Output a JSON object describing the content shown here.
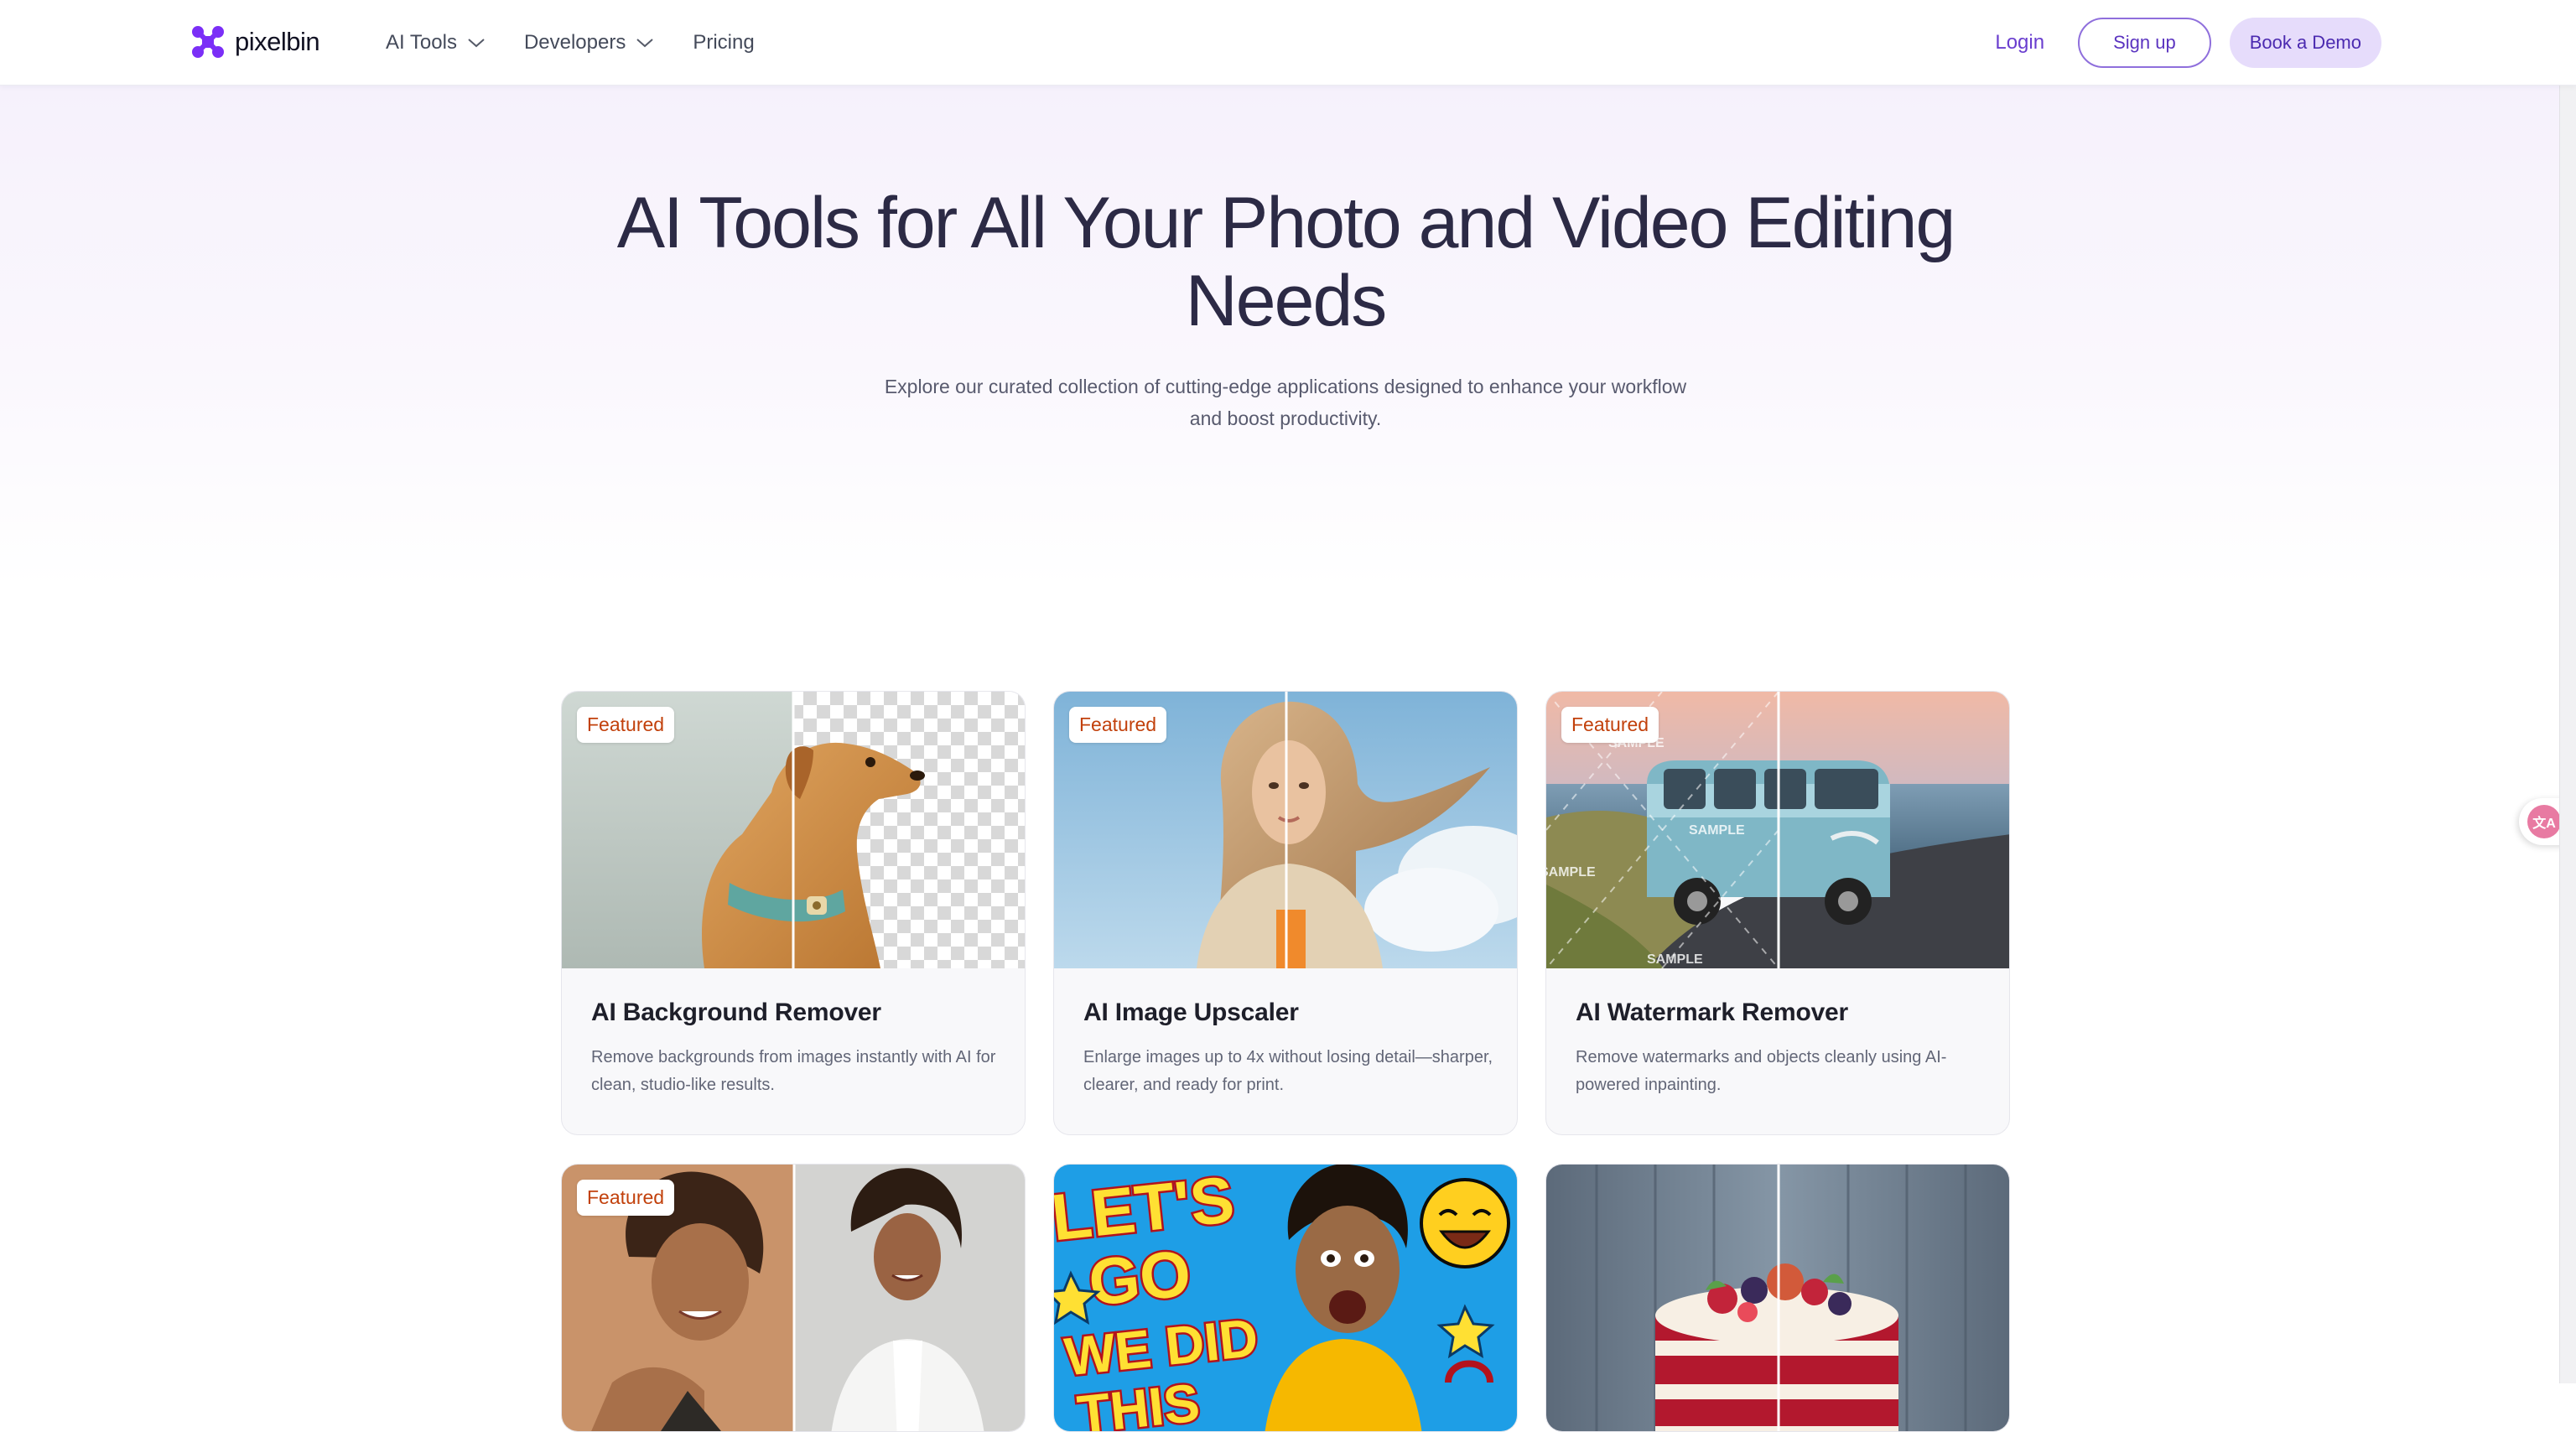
{
  "brand": {
    "name": "pixelbin",
    "accent": "#7b2ff7"
  },
  "nav": {
    "items": [
      {
        "label": "AI Tools"
      },
      {
        "label": "Developers"
      },
      {
        "label": "Pricing"
      }
    ]
  },
  "header_actions": {
    "login": "Login",
    "signup": "Sign up",
    "demo": "Book a Demo"
  },
  "hero": {
    "title_line1": "AI Tools for All Your Photo and Video Editing",
    "title_line2": "Needs",
    "subtitle_line1": "Explore our curated collection of cutting-edge applications designed to enhance your workflow",
    "subtitle_line2": "and boost productivity."
  },
  "cards": [
    {
      "badge": "Featured",
      "title": "AI Background Remover",
      "description": "Remove backgrounds from images instantly with AI for clean, studio-like results."
    },
    {
      "badge": "Featured",
      "title": "AI Image Upscaler",
      "description": "Enlarge images up to 4x without losing detail—sharper, clearer, and ready for print."
    },
    {
      "badge": "Featured",
      "title": "AI Watermark Remover",
      "description": "Remove watermarks and objects cleanly using AI-powered inpainting.",
      "watermarks": [
        "SAMPLE",
        "SAMPLE",
        "SAMPLE",
        "SAMPLE"
      ]
    },
    {
      "badge": "Featured"
    },
    {
      "image_text": [
        "LET'S",
        "GO",
        "WE DID",
        "THIS"
      ]
    },
    {}
  ],
  "widget": {
    "icon": "translate-icon",
    "glyph": "文A"
  }
}
